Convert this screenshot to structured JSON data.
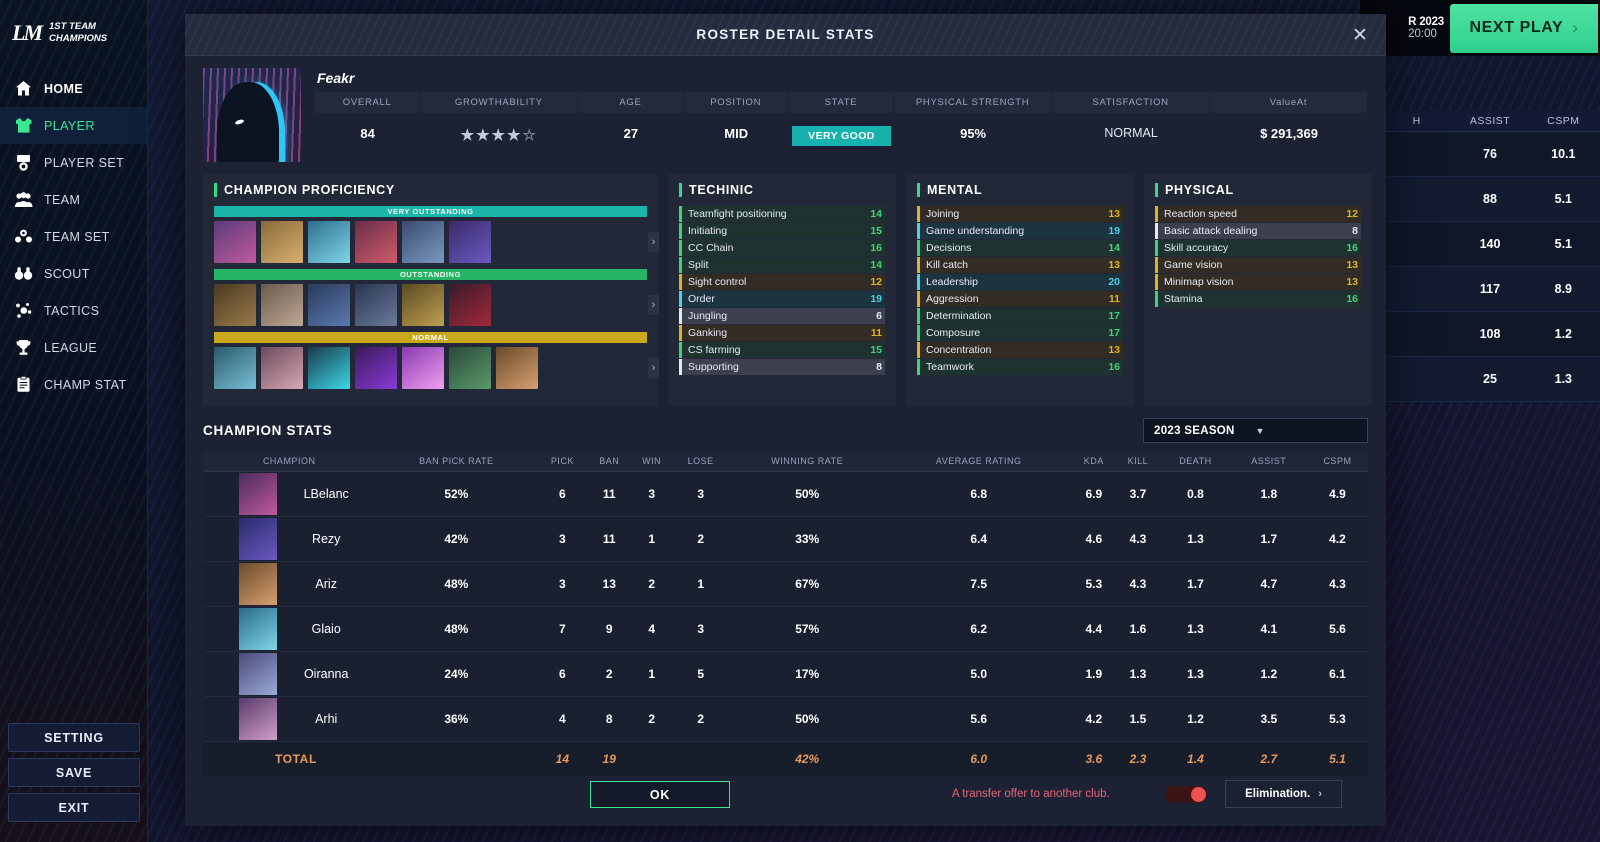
{
  "brand": {
    "logo": "LM",
    "line1": "1ST TEAM",
    "line2": "CHAMPIONS"
  },
  "sidebar": {
    "items": [
      {
        "label": "HOME",
        "icon": "home-icon"
      },
      {
        "label": "PLAYER",
        "icon": "jersey-icon"
      },
      {
        "label": "PLAYER SET",
        "icon": "player-set-icon"
      },
      {
        "label": "TEAM",
        "icon": "team-icon"
      },
      {
        "label": "TEAM SET",
        "icon": "team-set-icon"
      },
      {
        "label": "SCOUT",
        "icon": "binoculars-icon"
      },
      {
        "label": "TACTICS",
        "icon": "tactics-icon"
      },
      {
        "label": "LEAGUE",
        "icon": "trophy-icon"
      },
      {
        "label": "CHAMP STAT",
        "icon": "clipboard-icon"
      }
    ],
    "active": "PLAYER",
    "buttons": [
      "SETTING",
      "SAVE",
      "EXIT"
    ]
  },
  "topbar": {
    "date": "R 2023",
    "time": "20:00",
    "next_play": "NEXT PLAY",
    "chevron": "›"
  },
  "background_table": {
    "columns": [
      "H",
      "ASSIST",
      "CSPM"
    ],
    "rows": [
      [
        "",
        "76",
        "10.1"
      ],
      [
        "",
        "88",
        "5.1"
      ],
      [
        "",
        "140",
        "5.1"
      ],
      [
        "",
        "117",
        "8.9"
      ],
      [
        "",
        "108",
        "1.2"
      ],
      [
        "",
        "25",
        "1.3"
      ]
    ]
  },
  "modal": {
    "title": "ROSTER DETAIL STATS",
    "close_icon": "close-icon"
  },
  "player": {
    "name": "Feakr",
    "portrait_icon": "player-portrait",
    "attributes": [
      {
        "label": "OVERALL",
        "value": "84"
      },
      {
        "label": "GROWTHABILITY",
        "value": "4"
      },
      {
        "label": "AGE",
        "value": "27"
      },
      {
        "label": "POSITION",
        "value": "MID"
      },
      {
        "label": "STATE",
        "value": "VERY GOOD"
      },
      {
        "label": "PHYSICAL STRENGTH",
        "value": "95%"
      },
      {
        "label": "SATISFACTION",
        "value": "NORMAL"
      },
      {
        "label": "ValueAt",
        "value": "$ 291,369"
      }
    ],
    "growth_stars_filled": 4,
    "growth_stars_total": 5
  },
  "proficiency": {
    "title": "CHAMPION PROFICIENCY",
    "tiers": [
      {
        "label": "VERY OUTSTANDING",
        "color": "#1ab5a8",
        "count": 6,
        "icons": [
          "#5b3b7a,#c05a9e",
          "#8a6a3a,#d8b070",
          "#2f6f8f,#7fd6e8",
          "#6a2f4a,#d05a6a",
          "#3a4a70,#7a9ac0",
          "#3a2a6a,#6a5ac0"
        ]
      },
      {
        "label": "OUTSTANDING",
        "color": "#27b464",
        "count": 6,
        "icons": [
          "#4a3a22,#9a7a4a",
          "#6a5a4a,#c0a898",
          "#2a3a5a,#5a7ab0",
          "#2a3550,#6a7a9a",
          "#5a4a22,#c0a050",
          "#3a1a2a,#a02a3a"
        ]
      },
      {
        "label": "NORMAL",
        "color": "#c9a81e",
        "count": 7,
        "icons": [
          "#2a5a6a,#7ac0d8",
          "#6a4a5a,#d8a8b8",
          "#1a3a4a,#3ad8e8",
          "#3a1a5a,#8a3ad8",
          "#8a3ab0,#f0a0f0",
          "#2a4a3a,#5a9a6a",
          "#6a4a2a,#d8a070"
        ]
      }
    ],
    "arrow_icon": "chevron-right-icon"
  },
  "groups": [
    {
      "title": "TECHINIC",
      "stats": [
        {
          "name": "Teamfight positioning",
          "value": "14",
          "tier": "good"
        },
        {
          "name": "Initiating",
          "value": "15",
          "tier": "good"
        },
        {
          "name": "CC Chain",
          "value": "16",
          "tier": "good"
        },
        {
          "name": "Split",
          "value": "14",
          "tier": "good"
        },
        {
          "name": "Sight control",
          "value": "12",
          "tier": "mid"
        },
        {
          "name": "Order",
          "value": "19",
          "tier": "great"
        },
        {
          "name": "Jungling",
          "value": "6",
          "tier": "low"
        },
        {
          "name": "Ganking",
          "value": "11",
          "tier": "mid"
        },
        {
          "name": "CS farming",
          "value": "15",
          "tier": "good"
        },
        {
          "name": "Supporting",
          "value": "8",
          "tier": "low"
        }
      ]
    },
    {
      "title": "MENTAL",
      "stats": [
        {
          "name": "Joining",
          "value": "13",
          "tier": "mid"
        },
        {
          "name": "Game understanding",
          "value": "19",
          "tier": "great"
        },
        {
          "name": "Decisions",
          "value": "14",
          "tier": "good"
        },
        {
          "name": "Kill catch",
          "value": "13",
          "tier": "mid"
        },
        {
          "name": "Leadership",
          "value": "20",
          "tier": "great"
        },
        {
          "name": "Aggression",
          "value": "11",
          "tier": "mid"
        },
        {
          "name": "Determination",
          "value": "17",
          "tier": "good"
        },
        {
          "name": "Composure",
          "value": "17",
          "tier": "good"
        },
        {
          "name": "Concentration",
          "value": "13",
          "tier": "mid"
        },
        {
          "name": "Teamwork",
          "value": "16",
          "tier": "good"
        }
      ]
    },
    {
      "title": "PHYSICAL",
      "stats": [
        {
          "name": "Reaction speed",
          "value": "12",
          "tier": "mid"
        },
        {
          "name": "Basic attack dealing",
          "value": "8",
          "tier": "low"
        },
        {
          "name": "Skill accuracy",
          "value": "16",
          "tier": "good"
        },
        {
          "name": "Game vision",
          "value": "13",
          "tier": "mid"
        },
        {
          "name": "Minimap vision",
          "value": "13",
          "tier": "mid"
        },
        {
          "name": "Stamina",
          "value": "16",
          "tier": "good"
        }
      ]
    }
  ],
  "champion_stats": {
    "title": "CHAMPION STATS",
    "season": "2023 SEASON",
    "chevron": "▼",
    "columns": [
      "CHAMPION",
      "BAN PICK RATE",
      "PICK",
      "BAN",
      "WIN",
      "LOSE",
      "WINNING RATE",
      "AVERAGE RATING",
      "KDA",
      "KILL",
      "DEATH",
      "ASSIST",
      "CSPM"
    ],
    "rows": [
      {
        "icon": "#4a2a5a,#c05a9e",
        "champion": "LBelanc",
        "cells": [
          "52%",
          "6",
          "11",
          "3",
          "3",
          "50%",
          "6.8",
          "6.9",
          "3.7",
          "0.8",
          "1.8",
          "4.9"
        ]
      },
      {
        "icon": "#2a2a6a,#6a5ac0",
        "champion": "Rezy",
        "cells": [
          "42%",
          "3",
          "11",
          "1",
          "2",
          "33%",
          "6.4",
          "4.6",
          "4.3",
          "1.3",
          "1.7",
          "4.2"
        ]
      },
      {
        "icon": "#6a4a2a,#d8a070",
        "champion": "Ariz",
        "cells": [
          "48%",
          "3",
          "13",
          "2",
          "1",
          "67%",
          "7.5",
          "5.3",
          "4.3",
          "1.7",
          "4.7",
          "4.3"
        ]
      },
      {
        "icon": "#2a6a8a,#7fd6e8",
        "champion": "Glaio",
        "cells": [
          "48%",
          "7",
          "9",
          "4",
          "3",
          "57%",
          "6.2",
          "4.4",
          "1.6",
          "1.3",
          "4.1",
          "5.6"
        ]
      },
      {
        "icon": "#4a4a7a,#9aaad8",
        "champion": "Oiranna",
        "cells": [
          "24%",
          "6",
          "2",
          "1",
          "5",
          "17%",
          "5.0",
          "1.9",
          "1.3",
          "1.3",
          "1.2",
          "6.1"
        ]
      },
      {
        "icon": "#5a3a6a,#d0a0c8",
        "champion": "Arhi",
        "cells": [
          "36%",
          "4",
          "8",
          "2",
          "2",
          "50%",
          "5.6",
          "4.2",
          "1.5",
          "1.2",
          "3.5",
          "5.3"
        ]
      }
    ],
    "total": {
      "label": "TOTAL",
      "cells": [
        "",
        "14",
        "19",
        "",
        "",
        "42%",
        "6.0",
        "3.6",
        "2.3",
        "1.4",
        "2.7",
        "5.1"
      ]
    }
  },
  "footer": {
    "ok": "OK",
    "transfer_note": "A transfer offer to another club.",
    "toggle_on": true,
    "elimination": "Elimination.",
    "elimination_chevron": "›"
  },
  "colors": {
    "accent_green": "#3ce68f",
    "tier_great": "#4ad2e8",
    "tier_good": "#45d07a",
    "tier_mid": "#d8b52a",
    "tier_low": "#e4e8f0",
    "total_orange": "#e89a5a",
    "state_teal": "#18b2ae",
    "transfer_red": "#e4667c"
  }
}
